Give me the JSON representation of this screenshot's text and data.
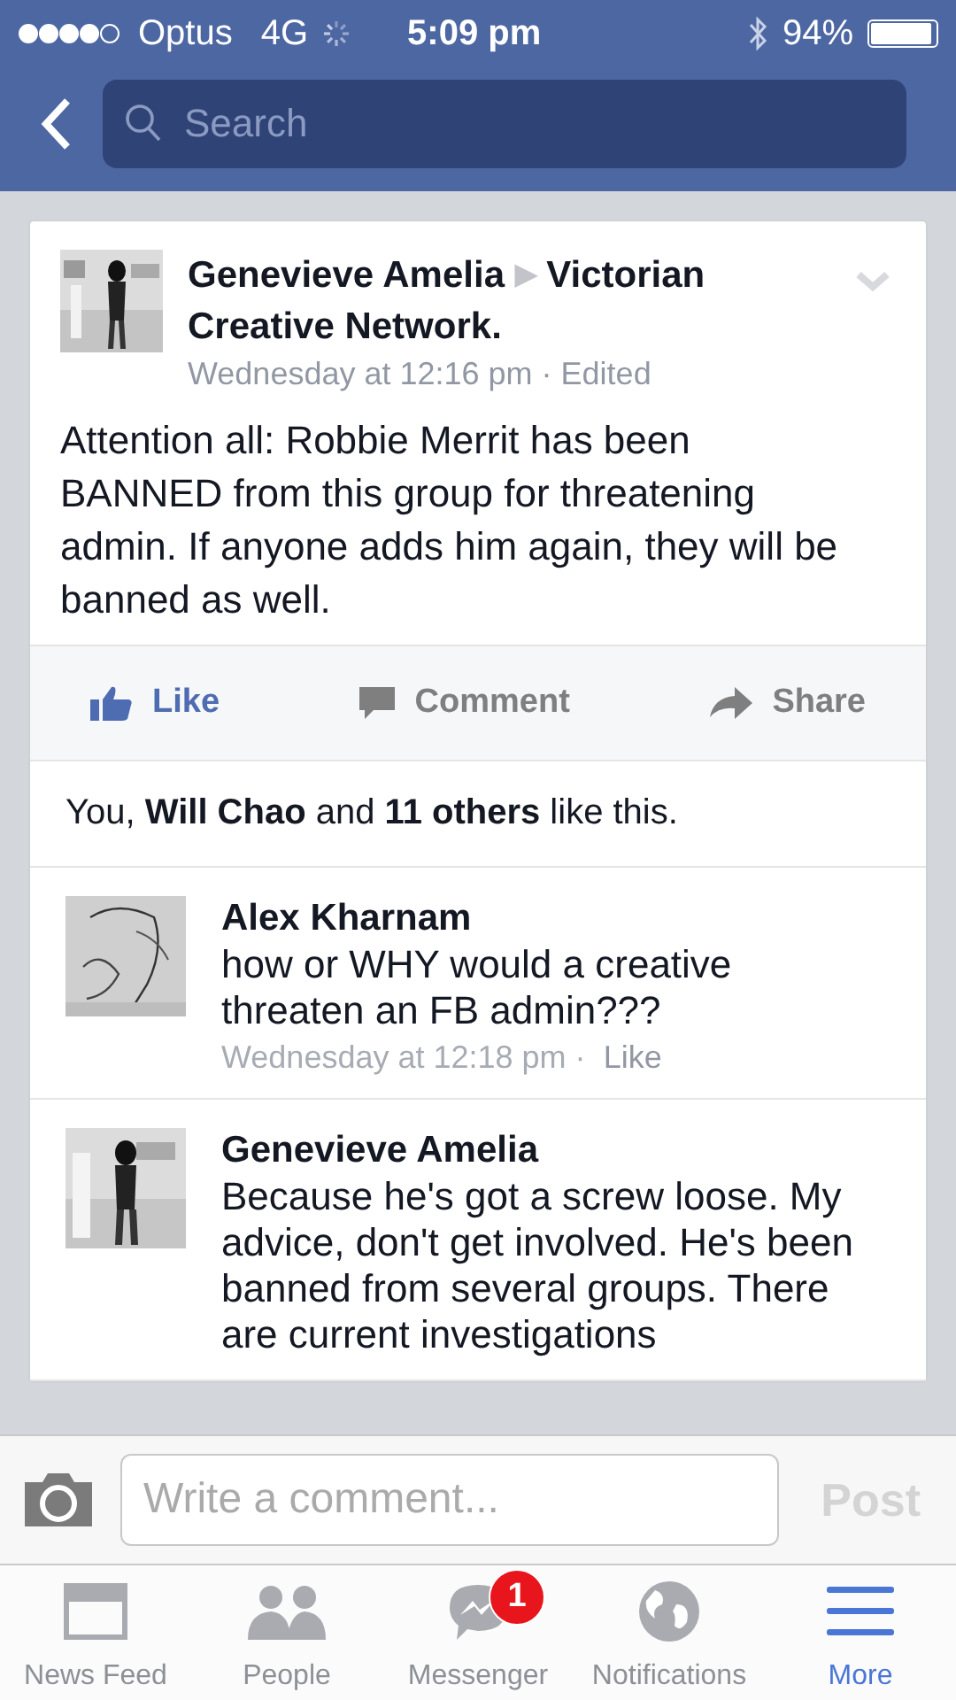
{
  "status_bar": {
    "carrier": "Optus",
    "network": "4G",
    "time": "5:09 pm",
    "battery": "94%"
  },
  "nav": {
    "search_placeholder": "Search"
  },
  "post": {
    "author": "Genevieve Amelia",
    "separator": "▶",
    "group": "Victorian Creative Network.",
    "meta": "Wednesday at 12:16 pm · Edited",
    "text": "Attention all: Robbie Merrit has been BANNED from this group for threatening admin. If anyone adds him again, they will be banned as well.",
    "actions": [
      {
        "kind": "like",
        "label": "Like",
        "selected": true
      },
      {
        "kind": "comment",
        "label": "Comment",
        "selected": false
      },
      {
        "kind": "share",
        "label": "Share",
        "selected": false
      }
    ],
    "likes_summary": "You, **Will Chao** and **11 others** like this."
  },
  "comments": [
    {
      "author": "Alex Kharnam",
      "text": "how or WHY would a creative threaten an FB admin???",
      "time": "Wednesday at 12:18 pm ·",
      "action": "Like"
    },
    {
      "author": "Genevieve Amelia",
      "text": "Because he's got a screw loose. My advice, don't get involved. He's been banned from several groups. There are current investigations"
    }
  ],
  "composer": {
    "placeholder": "Write a comment...",
    "post_label": "Post",
    "post_disabled": true
  },
  "tabs": [
    {
      "kind": "feed",
      "label": "News Feed",
      "selected": false
    },
    {
      "kind": "people",
      "label": "People",
      "selected": false
    },
    {
      "kind": "messenger",
      "label": "Messenger",
      "selected": false,
      "badge": "1"
    },
    {
      "kind": "globe",
      "label": "Notifications",
      "selected": false
    },
    {
      "kind": "menu",
      "label": "More",
      "selected": true
    }
  ]
}
